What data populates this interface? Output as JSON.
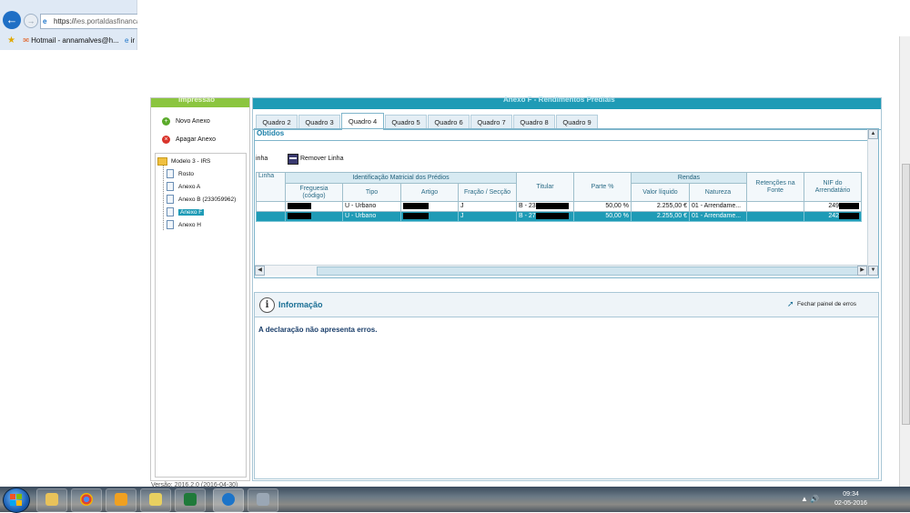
{
  "browser": {
    "url_scheme": "https://",
    "url_host": "ies.portaldasfinanca",
    "favorites": [
      {
        "label": "Hotmail - annamalves@h..."
      },
      {
        "label": "ir"
      }
    ]
  },
  "app": {
    "left_title": "Impressão",
    "main_title": "Anexo F - Rendimentos Prediais",
    "actions": {
      "new_annex": "Novo Anexo",
      "delete_annex": "Apagar Anexo"
    },
    "tree": {
      "root": "Modelo 3 - IRS",
      "items": [
        "Rosto",
        "Anexo A",
        "Anexo B (233059962)",
        "Anexo F",
        "Anexo H"
      ],
      "selected_index": 3
    },
    "version": "Versão: 2016.2.0 (2016-04-30)"
  },
  "tabs": [
    "Quadro 2",
    "Quadro 3",
    "Quadro 4",
    "Quadro 5",
    "Quadro 6",
    "Quadro 7",
    "Quadro 8",
    "Quadro 9"
  ],
  "active_tab": 2,
  "section": {
    "title": "Obtidos",
    "toolbar": {
      "partial_label": "inha",
      "remove_label": "Remover Linha"
    }
  },
  "grid": {
    "group_headers": {
      "identificacao": "Identificação Matricial dos Prédios",
      "rendas": "Rendas"
    },
    "columns": {
      "linha": "Linha",
      "freguesia": "Freguesia (código)",
      "tipo": "Tipo",
      "artigo": "Artigo",
      "fracao": "Fração / Secção",
      "titular": "Titular",
      "parte": "Parte %",
      "valor": "Valor líquido",
      "natureza": "Natureza",
      "retencoes": "Retenções na Fonte",
      "nif": "NIF do Arrendatário"
    },
    "rows": [
      {
        "tipo": "U - Urbano",
        "fracao": "J",
        "titular_prefix": "B - 23",
        "parte": "50,00 %",
        "valor": "2.255,00 €",
        "natureza": "01 - Arrendame...",
        "nif_prefix": "249"
      },
      {
        "tipo": "U - Urbano",
        "fracao": "J",
        "titular_prefix": "B - 27",
        "parte": "50,00 %",
        "valor": "2.255,00 €",
        "natureza": "01 - Arrendame...",
        "nif_prefix": "242"
      }
    ],
    "selected_row": 1
  },
  "info": {
    "title": "Informação",
    "close_label": "Fechar painel de erros",
    "message": "A declaração não apresenta erros."
  },
  "taskbar": {
    "time": "09:34",
    "date": "02-05-2016"
  }
}
